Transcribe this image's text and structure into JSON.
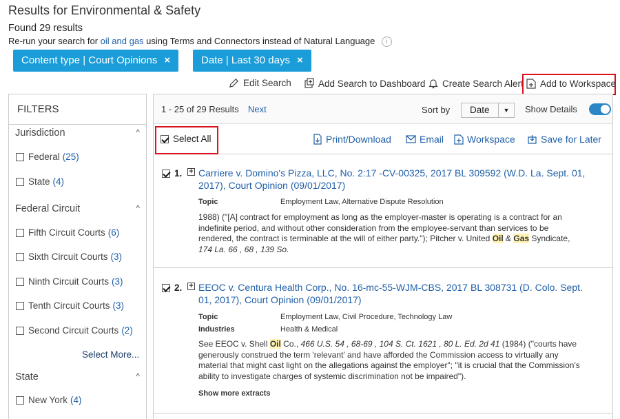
{
  "header": {
    "title": "Results for Environmental & Safety",
    "found": "Found 29 results",
    "rerun_prefix": "Re-run your search for ",
    "rerun_query": "oil and gas",
    "rerun_suffix": " using Terms and Connectors instead of Natural Language",
    "info_glyph": "i"
  },
  "chips": [
    {
      "label": "Content type | Court Opinions",
      "close": "×"
    },
    {
      "label": "Date | Last 30 days",
      "close": "×"
    }
  ],
  "toolbar": {
    "edit_search": "Edit Search",
    "add_dashboard": "Add Search to Dashboard",
    "create_alert": "Create Search Alert",
    "add_workspace": "Add to Workspace"
  },
  "filters": {
    "heading": "FILTERS",
    "caret": "^",
    "sections": [
      {
        "title": "Jurisdiction",
        "items": [
          {
            "label": "Federal",
            "count": "(25)"
          },
          {
            "label": "State",
            "count": "(4)"
          }
        ]
      },
      {
        "title": "Federal Circuit",
        "items": [
          {
            "label": "Fifth Circuit Courts",
            "count": "(6)"
          },
          {
            "label": "Sixth Circuit Courts",
            "count": "(3)"
          },
          {
            "label": "Ninth Circuit Courts",
            "count": "(3)"
          },
          {
            "label": "Tenth Circuit Courts",
            "count": "(3)"
          },
          {
            "label": "Second Circuit Courts",
            "count": "(2)"
          }
        ]
      },
      {
        "title": "State",
        "items": [
          {
            "label": "New York",
            "count": "(4)"
          }
        ]
      }
    ],
    "select_more": "Select More..."
  },
  "results_header": {
    "range": "1 - 25 of 29 Results",
    "next": "Next",
    "sort_label": "Sort by",
    "sort_value": "Date",
    "sort_arrow": "▼",
    "show_details": "Show Details",
    "show_details_on": true
  },
  "actions": {
    "select_all": "Select All",
    "print": "Print/Download",
    "email": "Email",
    "workspace": "Workspace",
    "save_later": "Save for Later"
  },
  "results": [
    {
      "num": "1.",
      "title": "Carriere v. Domino's Pizza, LLC, No. 2:17 -CV-00325, 2017 BL 309592 (W.D. La. Sept. 01, 2017), Court Opinion (09/01/2017)",
      "meta": [
        {
          "k": "Topic",
          "v": "Employment Law, Alternative Dispute Resolution"
        }
      ],
      "snippet": {
        "a": "1988) (\"[A] contract for employment as long as the employer-master is operating is a contract for an indefinite period, and without other consideration from the employee-servant than services to be rendered, the contract is terminable at the will of either party.\"); Pitcher v. United ",
        "h1": "Oil",
        "b": " & ",
        "h2": "Gas",
        "c": " Syndicate, ",
        "cite": "174 La. 66 , 68 , 139 So."
      }
    },
    {
      "num": "2.",
      "title": "EEOC v. Centura Health Corp., No. 16-mc-55-WJM-CBS, 2017 BL 308731 (D. Colo. Sept. 01, 2017), Court Opinion (09/01/2017)",
      "meta": [
        {
          "k": "Topic",
          "v": "Employment Law, Civil Procedure, Technology Law"
        },
        {
          "k": "Industries",
          "v": "Health & Medical"
        }
      ],
      "snippet": {
        "a": "See EEOC v. Shell ",
        "h1": "Oil",
        "b": " Co., ",
        "cite": "466 U.S. 54 , 68-69 , 104 S. Ct. 1621 , 80 L. Ed. 2d 41",
        "c": " (1984) (\"courts have generously construed the term 'relevant' and have afforded the Commission access to virtually any material that might cast light on the allegations against the employer\"; \"it is crucial that the Commission's ability to investigate charges of systemic discrimination not be impaired\")."
      },
      "show_more": "Show more extracts"
    }
  ],
  "colors": {
    "accent": "#1a9dd9",
    "link": "#1f5fa8",
    "highlight": "#fff2b3",
    "annotation_red": "#d9121f"
  }
}
